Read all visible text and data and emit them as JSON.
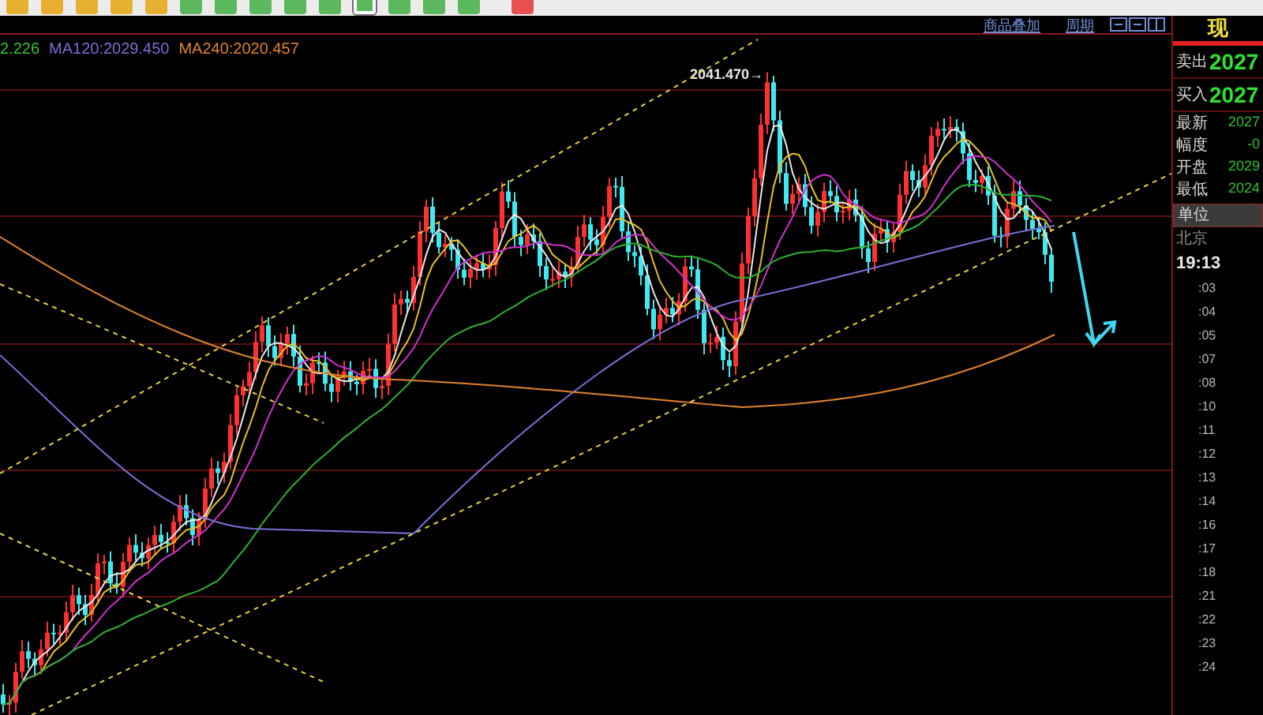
{
  "toolbar": {
    "buttons": [
      {
        "kind": "tool",
        "selected": false
      },
      {
        "kind": "tool",
        "selected": false
      },
      {
        "kind": "tool",
        "selected": false
      },
      {
        "kind": "tool",
        "selected": false
      },
      {
        "kind": "tool",
        "selected": false
      },
      {
        "kind": "period",
        "selected": false
      },
      {
        "kind": "period",
        "selected": false
      },
      {
        "kind": "period",
        "selected": false
      },
      {
        "kind": "period",
        "selected": false
      },
      {
        "kind": "period",
        "selected": false
      },
      {
        "kind": "period",
        "selected": true
      },
      {
        "kind": "period",
        "selected": false
      },
      {
        "kind": "period",
        "selected": false
      },
      {
        "kind": "period",
        "selected": false
      },
      {
        "kind": "alert",
        "selected": false
      }
    ]
  },
  "chart_header": {
    "links": [
      "商品叠加",
      "周期"
    ]
  },
  "legend": [
    {
      "text": "2.226",
      "color": "#36c236"
    },
    {
      "text": "MA120:2029.450",
      "color": "#7b6fd6"
    },
    {
      "text": "MA240:2020.457",
      "color": "#e0822e"
    }
  ],
  "chart": {
    "peak_label": "2041.470→"
  },
  "quote_panel": {
    "title": "现",
    "orders": [
      {
        "label": "卖出",
        "value": "2027"
      },
      {
        "label": "买入",
        "value": "2027"
      }
    ],
    "stats": [
      {
        "label": "最新",
        "value": "2027"
      },
      {
        "label": "幅度",
        "value": "-0"
      },
      {
        "label": "开盘",
        "value": "2029"
      },
      {
        "label": "最低",
        "value": "2024"
      }
    ],
    "unit_label": "单位",
    "city": "北京",
    "time": "19:13",
    "ticks": [
      ":03",
      ":04",
      ":05",
      ":07",
      ":08",
      ":10",
      ":11",
      ":12",
      ":13",
      ":14",
      ":16",
      ":17",
      ":18",
      ":21",
      ":22",
      ":23",
      ":24"
    ]
  }
}
